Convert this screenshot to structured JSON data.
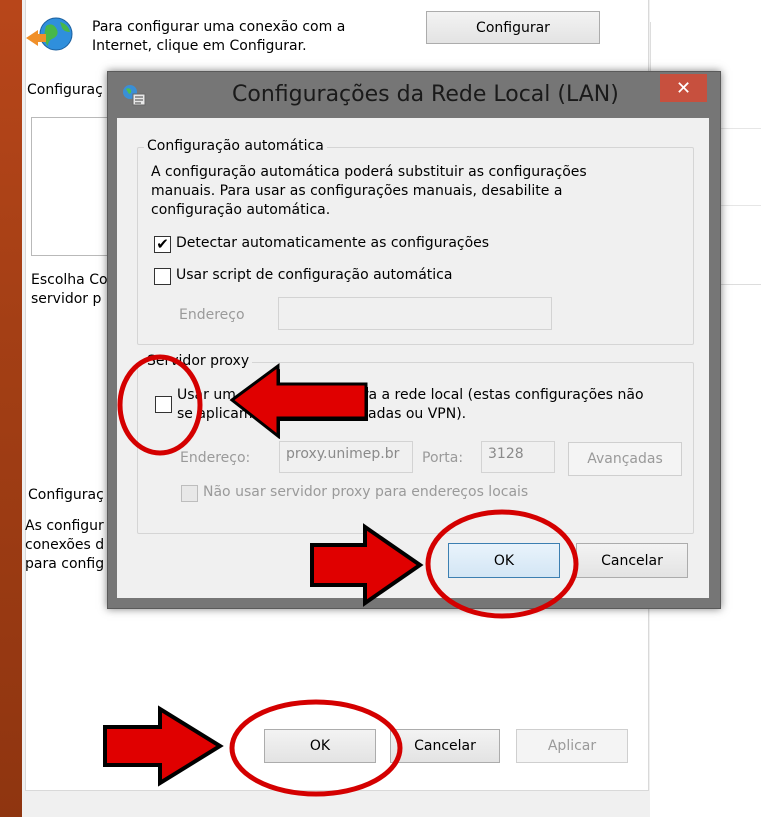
{
  "background": {
    "intro_text_line1": "Para configurar uma conexão com a",
    "intro_text_line2": "Internet, clique em Configurar.",
    "configurar_button": "Configurar",
    "section_dialup": "Configuraç",
    "choose_text_line1": "Escolha Co",
    "choose_text_line2": "servidor p",
    "section_lan": "Configuraç",
    "lan_text_line1": "As configur",
    "lan_text_line2": "conexões d",
    "lan_text_line3": "para config",
    "ok_button": "OK",
    "cancel_button": "Cancelar",
    "apply_button": "Aplicar"
  },
  "dialog": {
    "title": "Configurações da Rede Local (LAN)",
    "close_symbol": "✕",
    "auto_group_label": "Configuração automática",
    "auto_desc_line1": "A configuração automática poderá substituir as configurações",
    "auto_desc_line2": "manuais. Para usar as configurações manuais, desabilite a",
    "auto_desc_line3": "configuração automática.",
    "detect_label": "Detectar automaticamente as configurações",
    "detect_checked": true,
    "script_label": "Usar script de configuração automática",
    "script_checked": false,
    "address_label": "Endereço",
    "address_value": "",
    "proxy_group_label": "Servidor proxy",
    "proxy_use_line1": "Usar um servidor proxy para a rede local (estas configurações não",
    "proxy_use_line2": "se aplicam a conexões discadas ou VPN).",
    "proxy_checked": false,
    "proxy_address_label": "Endereço:",
    "proxy_address_value": "proxy.unimep.br",
    "port_label": "Porta:",
    "port_value": "3128",
    "advanced_button": "Avançadas",
    "bypass_label": "Não usar servidor proxy para endereços locais",
    "bypass_checked": false,
    "ok_button": "OK",
    "cancel_button": "Cancelar"
  },
  "colors": {
    "annotation_red": "#e00000",
    "annotation_circle": "#d40000",
    "close_button": "#c7503e",
    "dialog_frame": "#767676"
  }
}
